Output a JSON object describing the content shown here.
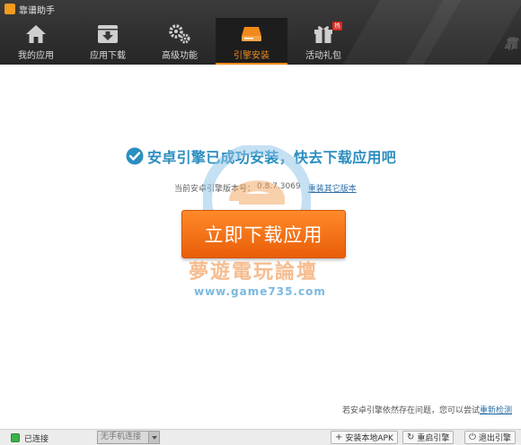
{
  "app": {
    "title": "靠谱助手",
    "brand": "靠"
  },
  "nav": [
    {
      "label": "我的应用",
      "icon": "home-icon",
      "active": false
    },
    {
      "label": "应用下载",
      "icon": "download-box-icon",
      "active": false
    },
    {
      "label": "高级功能",
      "icon": "gears-icon",
      "active": false
    },
    {
      "label": "引擎安装",
      "icon": "engine-drive-icon",
      "active": true
    },
    {
      "label": "活动礼包",
      "icon": "gift-icon",
      "active": false,
      "badge": "热"
    }
  ],
  "main": {
    "success_text": "安卓引擎已成功安装，快去下载应用吧",
    "version_label": "当前安卓引擎版本号：",
    "version_value": "0.8.7.3069",
    "reinstall_link": "重装其它版本",
    "download_button": "立即下载应用",
    "hint_text": "若安卓引擎依然存在问题，您可以尝试",
    "recheck_link": "重新检测"
  },
  "watermark": {
    "cn": "夢遊電玩論壇",
    "url": "www.game735.com"
  },
  "statusbar": {
    "connection": "已连接",
    "phone_select": "无手机连接",
    "install_apk": "安装本地APK",
    "restart_engine": "重启引擎",
    "exit_engine": "退出引擎"
  },
  "colors": {
    "accent": "#f08a1c",
    "success": "#2b8ec0",
    "button": "#f06a10"
  }
}
